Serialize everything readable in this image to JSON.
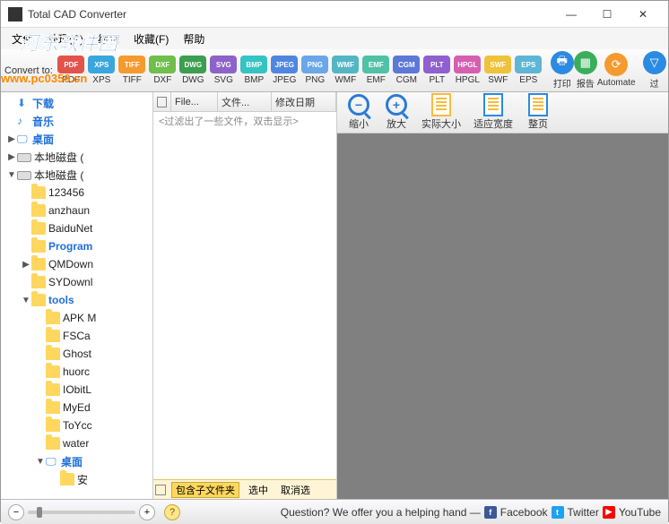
{
  "window": {
    "title": "Total CAD Converter"
  },
  "watermark": {
    "line1": "河东软件园",
    "line2": "www.pc0359.cn"
  },
  "menu": {
    "file": "文件",
    "process": "处理(P)",
    "edit": "编辑",
    "favorites": "收藏(F)",
    "help": "帮助"
  },
  "toolbar": {
    "convert_to": "Convert to:",
    "formats": [
      {
        "code": "PDF",
        "label": "PDF",
        "color": "#e2534b"
      },
      {
        "code": "XPS",
        "label": "XPS",
        "color": "#3aa6dd"
      },
      {
        "code": "TIFF",
        "label": "TIFF",
        "color": "#f59a2f"
      },
      {
        "code": "DXF",
        "label": "DXF",
        "color": "#6fbf4a"
      },
      {
        "code": "DWG",
        "label": "DWG",
        "color": "#3d9e4f"
      },
      {
        "code": "SVG",
        "label": "SVG",
        "color": "#8d62c9"
      },
      {
        "code": "BMP",
        "label": "BMP",
        "color": "#36c3c3"
      },
      {
        "code": "JPEG",
        "label": "JPEG",
        "color": "#4f86e0"
      },
      {
        "code": "PNG",
        "label": "PNG",
        "color": "#6aa7e8"
      },
      {
        "code": "WMF",
        "label": "WMF",
        "color": "#53b6c4"
      },
      {
        "code": "EMF",
        "label": "EMF",
        "color": "#4fc1a6"
      },
      {
        "code": "CGM",
        "label": "CGM",
        "color": "#5d78d6"
      },
      {
        "code": "PLT",
        "label": "PLT",
        "color": "#905fd0"
      },
      {
        "code": "HPGL",
        "label": "HPGL",
        "color": "#d65fb0"
      },
      {
        "code": "SWF",
        "label": "SWF",
        "color": "#efc23c"
      },
      {
        "code": "EPS",
        "label": "EPS",
        "color": "#5fb5d6"
      }
    ],
    "print": "打印",
    "report": "报告",
    "automate": "Automate",
    "filter": "过"
  },
  "tree": {
    "items": [
      {
        "indent": 0,
        "arrow": "",
        "icon": "download",
        "label": "下载",
        "color": "blue"
      },
      {
        "indent": 0,
        "arrow": "",
        "icon": "music",
        "label": "音乐",
        "color": "blue"
      },
      {
        "indent": 0,
        "arrow": "▶",
        "icon": "desktop",
        "label": "桌面",
        "color": "blue"
      },
      {
        "indent": 0,
        "arrow": "▶",
        "icon": "disk",
        "label": "本地磁盘 (",
        "color": ""
      },
      {
        "indent": 0,
        "arrow": "▼",
        "icon": "disk",
        "label": "本地磁盘 (",
        "color": ""
      },
      {
        "indent": 1,
        "arrow": "",
        "icon": "folder",
        "label": "123456",
        "color": ""
      },
      {
        "indent": 1,
        "arrow": "",
        "icon": "folder",
        "label": "anzhaun",
        "color": ""
      },
      {
        "indent": 1,
        "arrow": "",
        "icon": "folder",
        "label": "BaiduNet",
        "color": ""
      },
      {
        "indent": 1,
        "arrow": "",
        "icon": "folder",
        "label": "Program",
        "color": "blue"
      },
      {
        "indent": 1,
        "arrow": "▶",
        "icon": "folder",
        "label": "QMDown",
        "color": ""
      },
      {
        "indent": 1,
        "arrow": "",
        "icon": "folder",
        "label": "SYDownl",
        "color": ""
      },
      {
        "indent": 1,
        "arrow": "▼",
        "icon": "folder",
        "label": "tools",
        "color": "blue"
      },
      {
        "indent": 2,
        "arrow": "",
        "icon": "folder",
        "label": "APK M",
        "color": ""
      },
      {
        "indent": 2,
        "arrow": "",
        "icon": "folder",
        "label": "FSCa",
        "color": ""
      },
      {
        "indent": 2,
        "arrow": "",
        "icon": "folder",
        "label": "Ghost",
        "color": ""
      },
      {
        "indent": 2,
        "arrow": "",
        "icon": "folder",
        "label": "huorc",
        "color": ""
      },
      {
        "indent": 2,
        "arrow": "",
        "icon": "folder",
        "label": "IObitL",
        "color": ""
      },
      {
        "indent": 2,
        "arrow": "",
        "icon": "folder",
        "label": "MyEd",
        "color": ""
      },
      {
        "indent": 2,
        "arrow": "",
        "icon": "folder",
        "label": "ToYcc",
        "color": ""
      },
      {
        "indent": 2,
        "arrow": "",
        "icon": "folder",
        "label": "water",
        "color": ""
      },
      {
        "indent": 2,
        "arrow": "▼",
        "icon": "desktop",
        "label": "桌面",
        "color": "blue"
      },
      {
        "indent": 3,
        "arrow": "",
        "icon": "folder",
        "label": "安",
        "color": ""
      }
    ]
  },
  "list": {
    "col_check": "",
    "col_file": "File...",
    "col_name": "文件...",
    "col_date": "修改日期",
    "filtered_hint": "<过滤出了一些文件，双击显示>",
    "include_sub": "包含子文件夹",
    "select": "选中",
    "deselect": "取消选"
  },
  "preview": {
    "zoom_out": "缩小",
    "zoom_in": "放大",
    "actual_size": "实际大小",
    "fit_width": "适应宽度",
    "full_page": "整页"
  },
  "status": {
    "question": "Question? We offer you a helping hand —",
    "facebook": "Facebook",
    "twitter": "Twitter",
    "youtube": "YouTube"
  }
}
